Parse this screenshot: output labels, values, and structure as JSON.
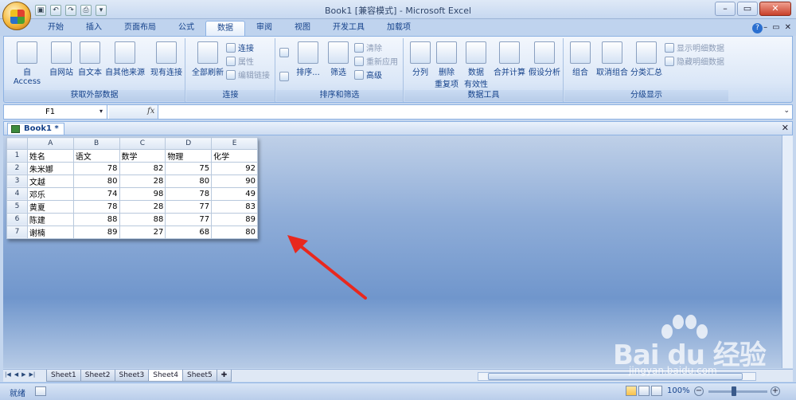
{
  "window": {
    "title": "Book1  [兼容模式] - Microsoft Excel"
  },
  "qat": [
    "save-icon",
    "undo-icon",
    "redo-icon",
    "print-preview-icon",
    "customize-icon"
  ],
  "tabs": [
    "开始",
    "插入",
    "页面布局",
    "公式",
    "数据",
    "审阅",
    "视图",
    "开发工具",
    "加载项"
  ],
  "active_tab": "数据",
  "ribbon": {
    "get_external": {
      "label": "获取外部数据",
      "buttons": [
        "自 Access",
        "自网站",
        "自文本",
        "自其他来源",
        "现有连接"
      ]
    },
    "connections": {
      "label": "连接",
      "refresh": "全部刷新",
      "items": [
        "连接",
        "属性",
        "编辑链接"
      ]
    },
    "sort_filter": {
      "label": "排序和筛选",
      "sort": "排序...",
      "filter": "筛选",
      "items": [
        "清除",
        "重新应用",
        "高级"
      ]
    },
    "data_tools": {
      "label": "数据工具",
      "buttons": [
        "分列",
        "删除",
        "重复项",
        "数据",
        "有效性",
        "合并计算",
        "假设分析"
      ]
    },
    "outline": {
      "label": "分级显示",
      "buttons": [
        "组合",
        "取消组合",
        "分类汇总"
      ],
      "items": [
        "显示明细数据",
        "隐藏明细数据"
      ]
    }
  },
  "formula_bar": {
    "name_box": "F1",
    "fx": "fx"
  },
  "workbook": {
    "tab": "Book1 *"
  },
  "grid": {
    "columns": [
      "A",
      "B",
      "C",
      "D",
      "E"
    ],
    "rows": [
      {
        "n": "1",
        "cells": [
          "姓名",
          "语文",
          "数学",
          "物理",
          "化学"
        ]
      },
      {
        "n": "2",
        "cells": [
          "朱米娜",
          "78",
          "82",
          "75",
          "92"
        ]
      },
      {
        "n": "3",
        "cells": [
          "文越",
          "80",
          "28",
          "80",
          "90"
        ]
      },
      {
        "n": "4",
        "cells": [
          "邓乐",
          "74",
          "98",
          "78",
          "49"
        ]
      },
      {
        "n": "5",
        "cells": [
          "黄夏",
          "78",
          "28",
          "77",
          "83"
        ]
      },
      {
        "n": "6",
        "cells": [
          "陈建",
          "88",
          "88",
          "77",
          "89"
        ]
      },
      {
        "n": "7",
        "cells": [
          "谢楠",
          "89",
          "27",
          "68",
          "80"
        ]
      }
    ]
  },
  "sheet_tabs": [
    "Sheet1",
    "Sheet2",
    "Sheet3",
    "Sheet4",
    "Sheet5"
  ],
  "active_sheet": "Sheet4",
  "status": {
    "ready": "就绪",
    "zoom": "100%"
  },
  "watermark": {
    "text": "Bai du 经验",
    "url": "jingyan.baidu.com"
  },
  "colors": {
    "accent": "#15428b",
    "arrow": "#e8281e"
  }
}
